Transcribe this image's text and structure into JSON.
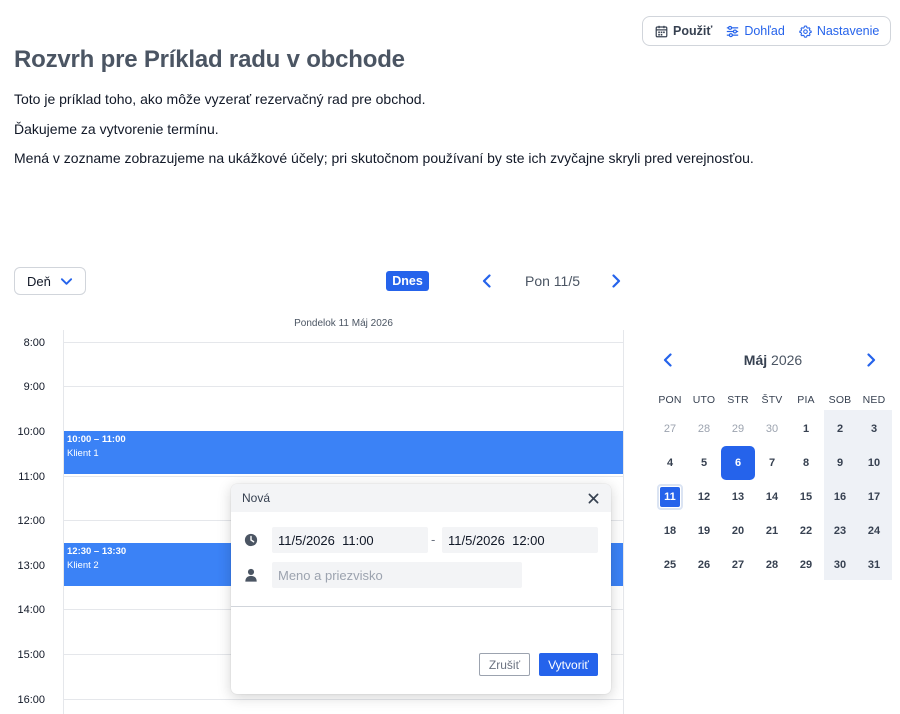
{
  "toolbar": {
    "use_label": "Použiť",
    "view_label": "Dohľad",
    "settings_label": "Nastavenie"
  },
  "page": {
    "title": "Rozvrh pre Príklad radu v obchode",
    "paragraphs": [
      "Toto je príklad toho, ako môže vyzerať rezervačný rad pre obchod.",
      "Ďakujeme za vytvorenie termínu.",
      "Mená v zozname zobrazujeme na ukážkové účely; pri skutočnom používaní by ste ich zvyčajne skryli pred verejnosťou."
    ]
  },
  "controls": {
    "view_mode": "Deň",
    "today_label": "Dnes",
    "current_date": "Pon 11/5"
  },
  "day_view": {
    "header": "Pondelok 11 Máj 2026",
    "times": [
      "8:00",
      "9:00",
      "10:00",
      "11:00",
      "12:00",
      "13:00",
      "14:00",
      "15:00",
      "16:00"
    ],
    "events": [
      {
        "time": "10:00 – 11:00",
        "name": "Klient 1"
      },
      {
        "time": "12:30 – 13:30",
        "name": "Klient 2"
      }
    ]
  },
  "popup": {
    "title": "Nová",
    "start_value": "11/5/2026  11:00",
    "separator": "-",
    "end_value": "11/5/2026  12:00",
    "name_placeholder": "Meno a priezvisko",
    "cancel_label": "Zrušiť",
    "create_label": "Vytvoriť"
  },
  "mini_calendar": {
    "month": "Máj",
    "year": "2026",
    "weekdays": [
      "PON",
      "UTO",
      "STR",
      "ŠTV",
      "PIA",
      "SOB",
      "NED"
    ],
    "weeks": [
      [
        "27",
        "28",
        "29",
        "30",
        "1",
        "2",
        "3"
      ],
      [
        "4",
        "5",
        "6",
        "7",
        "8",
        "9",
        "10"
      ],
      [
        "11",
        "12",
        "13",
        "14",
        "15",
        "16",
        "17"
      ],
      [
        "18",
        "19",
        "20",
        "21",
        "22",
        "23",
        "24"
      ],
      [
        "25",
        "26",
        "27",
        "28",
        "29",
        "30",
        "31"
      ]
    ],
    "muted_in_first_week": 4,
    "today_day": "6",
    "selected_day": "11"
  },
  "colors": {
    "accent": "#2563eb",
    "event": "#3b82f6",
    "title": "#4b5563"
  },
  "icons": {
    "use": "calendar-icon",
    "view": "sliders-icon",
    "settings": "gear-icon",
    "view_select": "chevron-down-icon",
    "prev": "chevron-left-icon",
    "next": "chevron-right-icon",
    "close": "close-icon",
    "time": "clock-icon",
    "person": "user-icon"
  }
}
